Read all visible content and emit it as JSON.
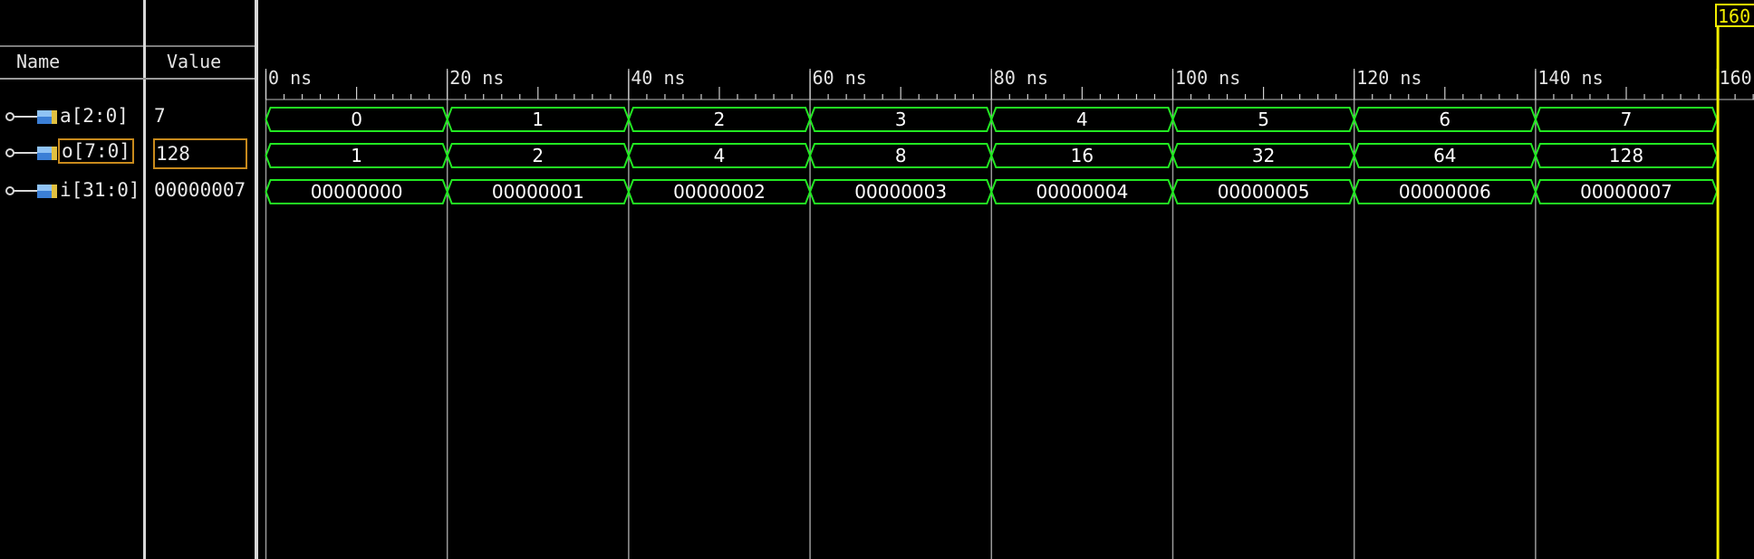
{
  "headers": {
    "name": "Name",
    "value": "Value"
  },
  "signals": [
    {
      "name": "a[2:0]",
      "value": "7",
      "icon": "bus-signal-icon",
      "selected": false,
      "segments": [
        "0",
        "1",
        "2",
        "3",
        "4",
        "5",
        "6",
        "7"
      ]
    },
    {
      "name": "o[7:0]",
      "value": "128",
      "icon": "bus-signal-icon",
      "selected": true,
      "segments": [
        "1",
        "2",
        "4",
        "8",
        "16",
        "32",
        "64",
        "128"
      ]
    },
    {
      "name": "i[31:0]",
      "value": "00000007",
      "icon": "bus-signal-icon",
      "selected": false,
      "segments": [
        "00000000",
        "00000001",
        "00000002",
        "00000003",
        "00000004",
        "00000005",
        "00000006",
        "00000007"
      ]
    }
  ],
  "timeline": {
    "labels": [
      "0 ns",
      "20 ns",
      "40 ns",
      "60 ns",
      "80 ns",
      "100 ns",
      "120 ns",
      "140 ns",
      "160"
    ],
    "major_step_ns": 20,
    "minor_ticks_per_major": 10,
    "range_ns": [
      0,
      160
    ],
    "cursor": {
      "time_ns": 160,
      "label": "160"
    }
  },
  "colors": {
    "background": "#000000",
    "waveform": "#22e822",
    "cursor": "#f2ee00",
    "selection": "#c88a1c",
    "gridline": "#9a9a9a",
    "text": "#e8e8e8"
  }
}
